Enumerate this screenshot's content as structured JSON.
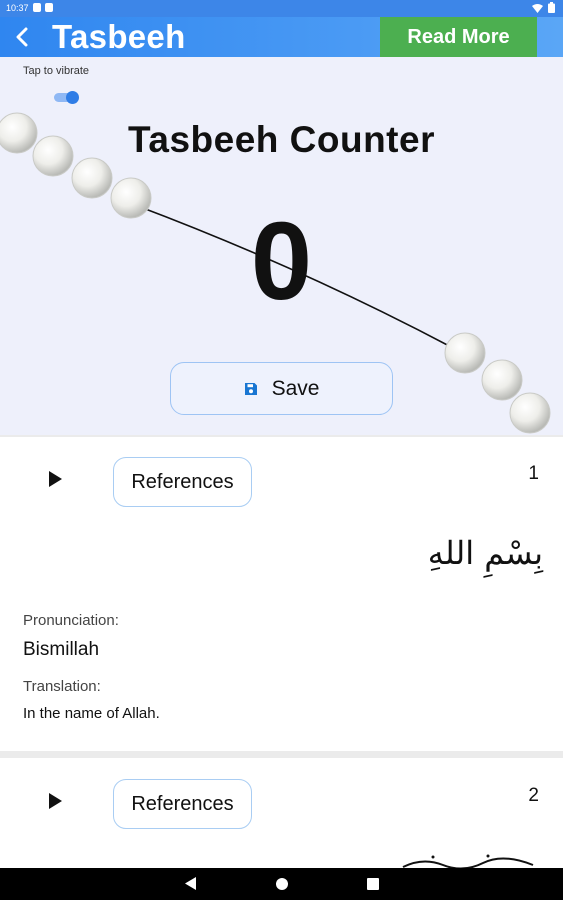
{
  "status_bar": {
    "time": "10:37"
  },
  "app_bar": {
    "title": "Tasbeeh",
    "read_more_label": "Read More",
    "back_icon": "chevron-left-icon",
    "colors": {
      "bar": "#2f86f0",
      "read_more": "#4caf50"
    }
  },
  "counter": {
    "vibrate_label": "Tap to vibrate",
    "vibrate_enabled": true,
    "title": "Tasbeeh Counter",
    "value": "0",
    "save_label": "Save",
    "save_icon": "floppy-disk-icon"
  },
  "cards": [
    {
      "number": "1",
      "references_label": "References",
      "play_icon": "play-icon",
      "arabic": "بِسْمِ اللهِ",
      "pronunciation_label": "Pronunciation:",
      "pronunciation": "Bismillah",
      "translation_label": "Translation:",
      "translation": "In the name of Allah."
    },
    {
      "number": "2",
      "references_label": "References",
      "play_icon": "play-icon"
    }
  ],
  "nav_bar": {
    "back_icon": "triangle-back-icon",
    "home_icon": "circle-home-icon",
    "recent_icon": "square-recent-icon"
  }
}
